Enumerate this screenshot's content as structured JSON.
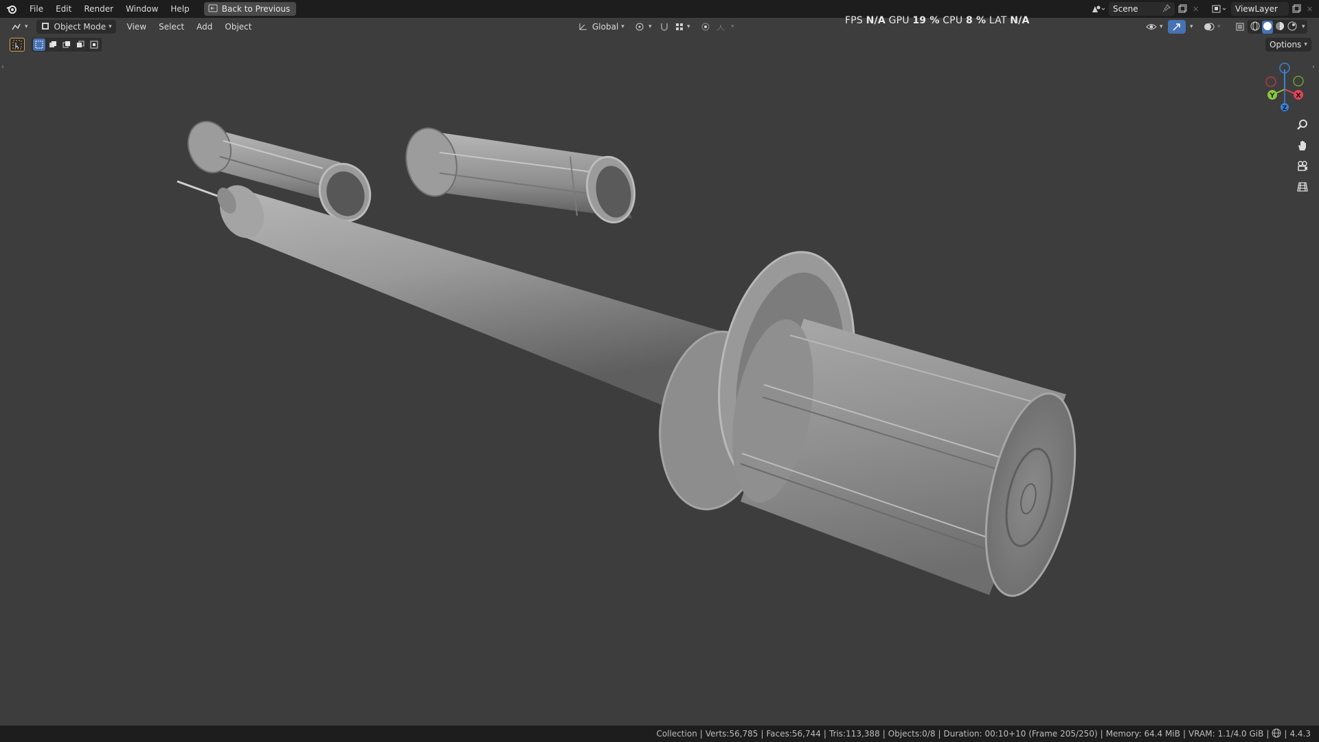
{
  "menu": {
    "items": [
      "File",
      "Edit",
      "Render",
      "Window",
      "Help"
    ],
    "back_label": "Back to Previous"
  },
  "scene_field": {
    "label": "Scene"
  },
  "view_layer_field": {
    "label": "ViewLayer"
  },
  "viewport_header": {
    "mode_label": "Object Mode",
    "menus": [
      "View",
      "Select",
      "Add",
      "Object"
    ],
    "orientation_label": "Global"
  },
  "stats": {
    "fps_label": "FPS",
    "fps_value": "N/A",
    "gpu_label": "GPU",
    "gpu_value": "19 %",
    "cpu_label": "CPU",
    "cpu_value": "8 %",
    "lat_label": "LAT",
    "lat_value": "N/A"
  },
  "options_label": "Options",
  "gizmo": {
    "x": "X",
    "y": "Y",
    "z": "Z"
  },
  "status_bar": {
    "collection": "Collection",
    "verts": "Verts:56,785",
    "faces": "Faces:56,744",
    "tris": "Tris:113,388",
    "objects": "Objects:0/8",
    "duration": "Duration: 00:10+10 (Frame 205/250)",
    "memory": "Memory: 64.4 MiB",
    "vram": "VRAM: 1.1/4.0 GiB",
    "version": "4.4.3"
  },
  "colors": {
    "viewport_bg": "#3d3d3d",
    "header_bg": "#1d1d1d",
    "accent": "#4772b3",
    "axis_x": "#e0445a",
    "axis_y": "#8cc63f",
    "axis_z": "#3b82d6"
  },
  "icons": [
    "blender-logo-icon",
    "back-icon",
    "scene-icon",
    "pin-icon",
    "new-scene-icon",
    "close-icon",
    "view-layer-icon",
    "editor-type-icon",
    "object-mode-icon",
    "transform-orientation-icon",
    "pivot-icon",
    "snap-icon",
    "snap-target-icon",
    "proportional-edit-icon",
    "falloff-icon",
    "visibility-icon",
    "gizmo-icon",
    "overlay-icon",
    "xray-icon",
    "wireframe-shading-icon",
    "solid-shading-icon",
    "material-shading-icon",
    "rendered-shading-icon",
    "zoom-icon",
    "hand-icon",
    "camera-icon",
    "grid-icon",
    "select-box-icon"
  ]
}
